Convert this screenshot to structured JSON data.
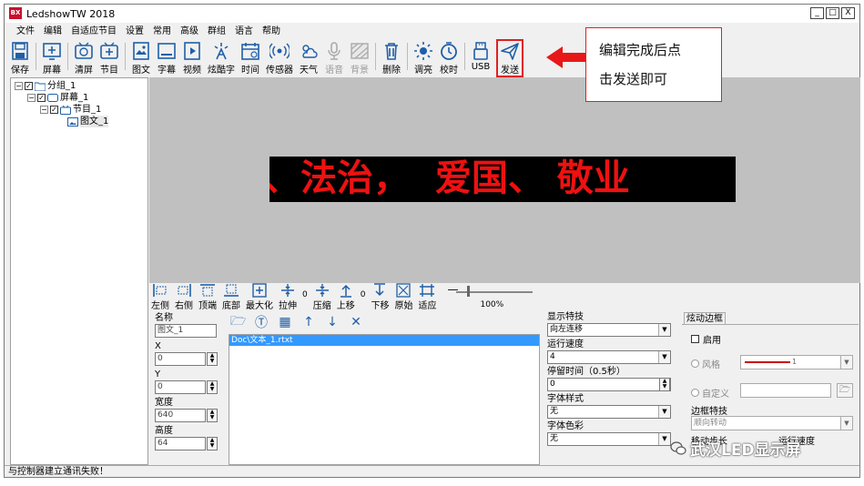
{
  "window": {
    "title": "LedshowTW 2018",
    "app_icon_text": "BX",
    "min_label": "_",
    "max_label": "□",
    "close_label": "X"
  },
  "menu": [
    "文件",
    "编辑",
    "自适应节目",
    "设置",
    "常用",
    "高级",
    "群组",
    "语言",
    "帮助"
  ],
  "toolbar": {
    "save": "保存",
    "screen": "屏幕",
    "clear": "清屏",
    "program": "节目",
    "graphic_text": "图文",
    "subtitle": "字幕",
    "video": "视频",
    "cool_text": "炫酷字",
    "time": "时间",
    "sensor": "传感器",
    "weather": "天气",
    "voice": "语音",
    "background": "背景",
    "delete": "删除",
    "brightness": "调亮",
    "timing": "校时",
    "usb": "USB",
    "send": "发送"
  },
  "tree": {
    "group": "分组_1",
    "screen": "屏幕_1",
    "program": "节目_1",
    "area": "图文_1"
  },
  "led_display": {
    "text": "、法治，  爱国、 敬业",
    "color": "#ee1111"
  },
  "edit_bar": {
    "left": "左侧",
    "right": "右侧",
    "top": "顶端",
    "bottom": "底部",
    "maximize": "最大化",
    "stretch": "拉伸",
    "stretch_value": "0",
    "compress": "压缩",
    "move_up": "上移",
    "move_value": "0",
    "move_down": "下移",
    "original": "原始",
    "fit": "适应",
    "zoom_minus": "—",
    "zoom_percent": "100%"
  },
  "properties": {
    "name_label": "名称",
    "name_value": "图文_1",
    "x_label": "X",
    "x_value": "0",
    "y_label": "Y",
    "y_value": "0",
    "width_label": "宽度",
    "width_value": "640",
    "height_label": "高度",
    "height_value": "64"
  },
  "file_list": {
    "items": [
      "Doc\\文本_1.rtxt"
    ]
  },
  "effects": {
    "display_effect_label": "显示特技",
    "display_effect_value": "向左连移",
    "speed_label": "运行速度",
    "speed_value": "4",
    "dwell_label": "停留时间（0.5秒）",
    "dwell_value": "0",
    "font_style_label": "字体样式",
    "font_style_value": "无",
    "font_color_label": "字体色彩",
    "font_color_value": "无"
  },
  "border": {
    "tab_label": "炫动边框",
    "enable_label": "启用",
    "style_label": "风格",
    "style_value": "1",
    "custom_label": "自定义",
    "effect_label": "边框特技",
    "effect_value": "顺向转动",
    "step_label": "移动步长",
    "speed_label": "运行速度"
  },
  "status": {
    "message": "与控制器建立通讯失败！"
  },
  "annotation": {
    "line1": "编辑完成后点",
    "line2": "击发送即可"
  },
  "watermark": {
    "text": "武汉LED显示屏"
  }
}
